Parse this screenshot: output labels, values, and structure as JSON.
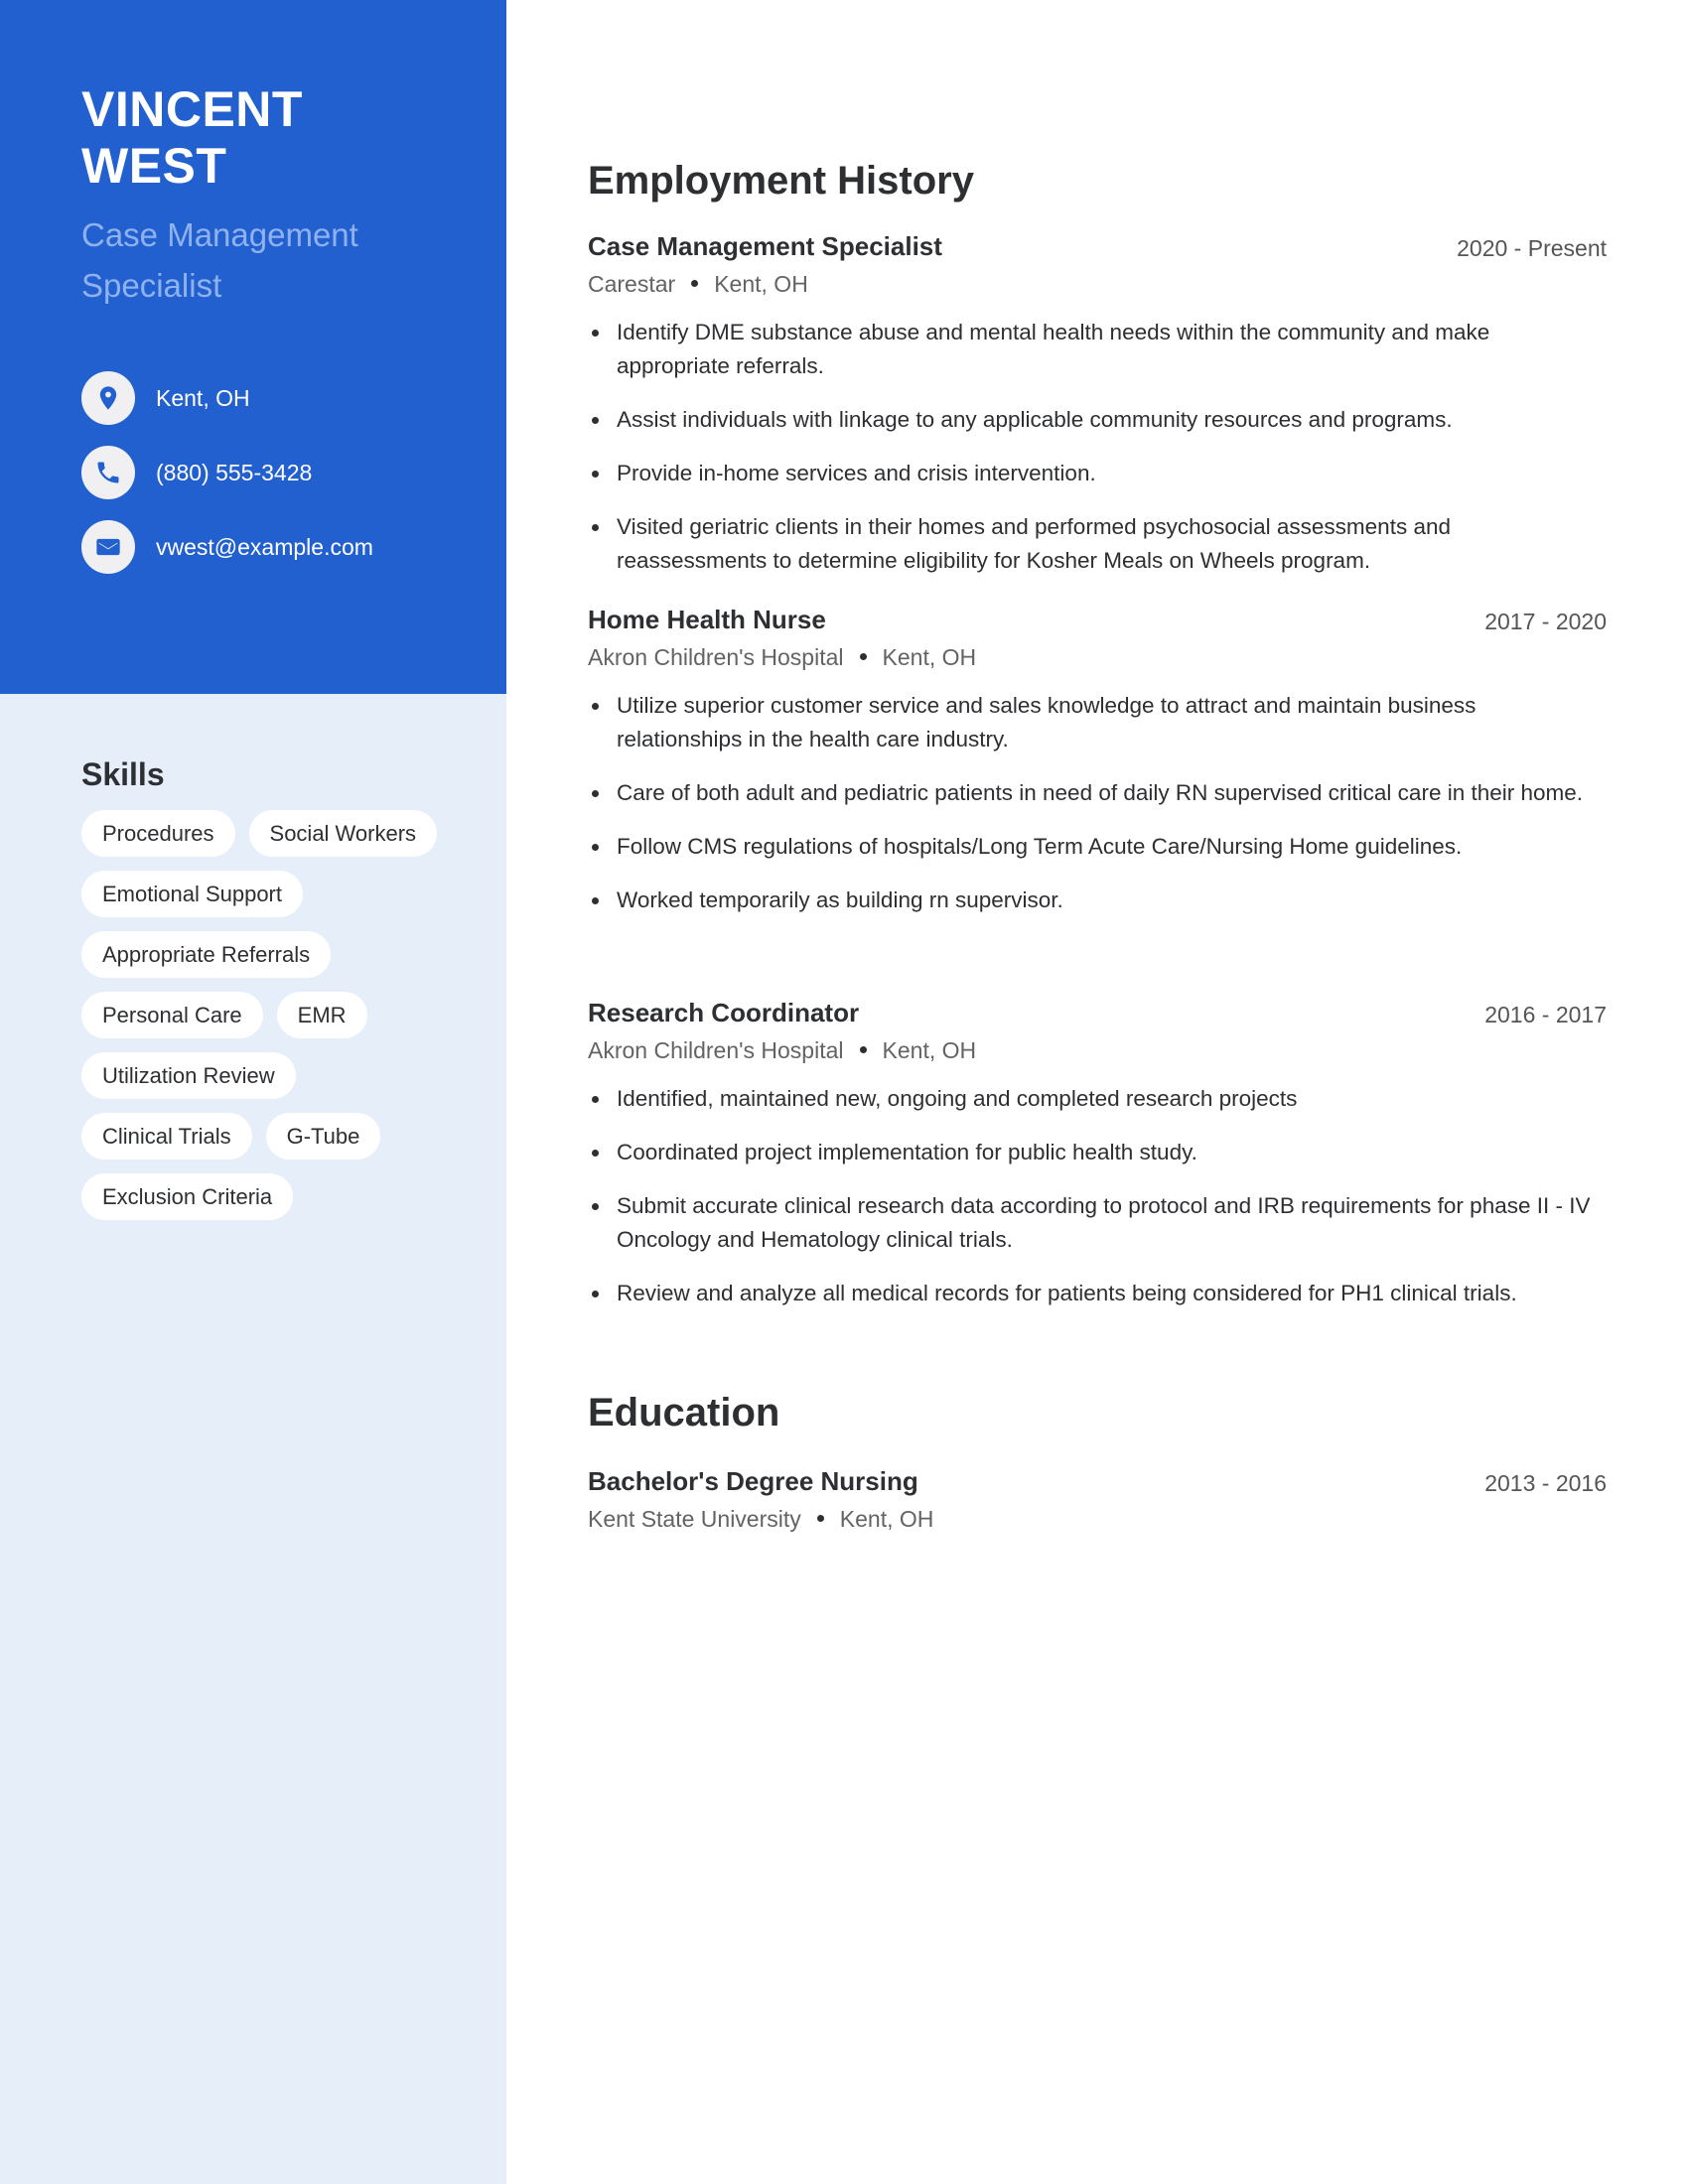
{
  "colors": {
    "accent": "#2260d0",
    "sidebar_bg": "#e6eefa",
    "subtitle": "#8fb2ef",
    "text": "#2d2f33",
    "muted": "#636363"
  },
  "profile": {
    "first_name": "VINCENT",
    "last_name": "WEST",
    "title": "Case Management Specialist"
  },
  "contacts": [
    {
      "icon": "location-pin-icon",
      "text": "Kent, OH"
    },
    {
      "icon": "phone-icon",
      "text": "(880) 555-3428"
    },
    {
      "icon": "email-icon",
      "text": "vwest@example.com"
    }
  ],
  "skills": {
    "heading": "Skills",
    "items": [
      "Procedures",
      "Social Workers",
      "Emotional Support",
      "Appropriate Referrals",
      "Personal Care",
      "EMR",
      "Utilization Review",
      "Clinical Trials",
      "G-Tube",
      "Exclusion Criteria"
    ]
  },
  "employment": {
    "heading": "Employment History",
    "jobs": [
      {
        "title": "Case Management Specialist",
        "dates": "2020 - Present",
        "company": "Carestar",
        "location": "Kent, OH",
        "bullets": [
          "Identify DME substance abuse and mental health needs within the community and make appropriate referrals.",
          "Assist individuals with linkage to any applicable community resources and programs.",
          "Provide in-home services and crisis intervention.",
          "Visited geriatric clients in their homes and performed psychosocial assessments and reassessments to determine eligibility for Kosher Meals on Wheels program."
        ]
      },
      {
        "title": "Home Health Nurse",
        "dates": "2017 - 2020",
        "company": "Akron Children's Hospital",
        "location": "Kent, OH",
        "bullets": [
          "Utilize superior customer service and sales knowledge to attract and maintain business relationships in the health care industry.",
          "Care of both adult and pediatric patients in need of daily RN supervised critical care in their home.",
          "Follow CMS regulations of hospitals/Long Term Acute Care/Nursing Home guidelines.",
          "Worked temporarily as building rn supervisor."
        ]
      },
      {
        "title": "Research Coordinator",
        "dates": "2016 - 2017",
        "company": "Akron Children's Hospital",
        "location": "Kent, OH",
        "bullets": [
          "Identified, maintained new, ongoing and completed research projects",
          "Coordinated project implementation for public health study.",
          "Submit accurate clinical research data according to protocol and IRB requirements for phase II - IV Oncology and Hematology clinical trials.",
          "Review and analyze all medical records for patients being considered for PH1 clinical trials."
        ]
      }
    ]
  },
  "education": {
    "heading": "Education",
    "items": [
      {
        "degree": "Bachelor's Degree Nursing",
        "dates": "2013 - 2016",
        "school": "Kent State University",
        "location": "Kent, OH"
      }
    ]
  }
}
